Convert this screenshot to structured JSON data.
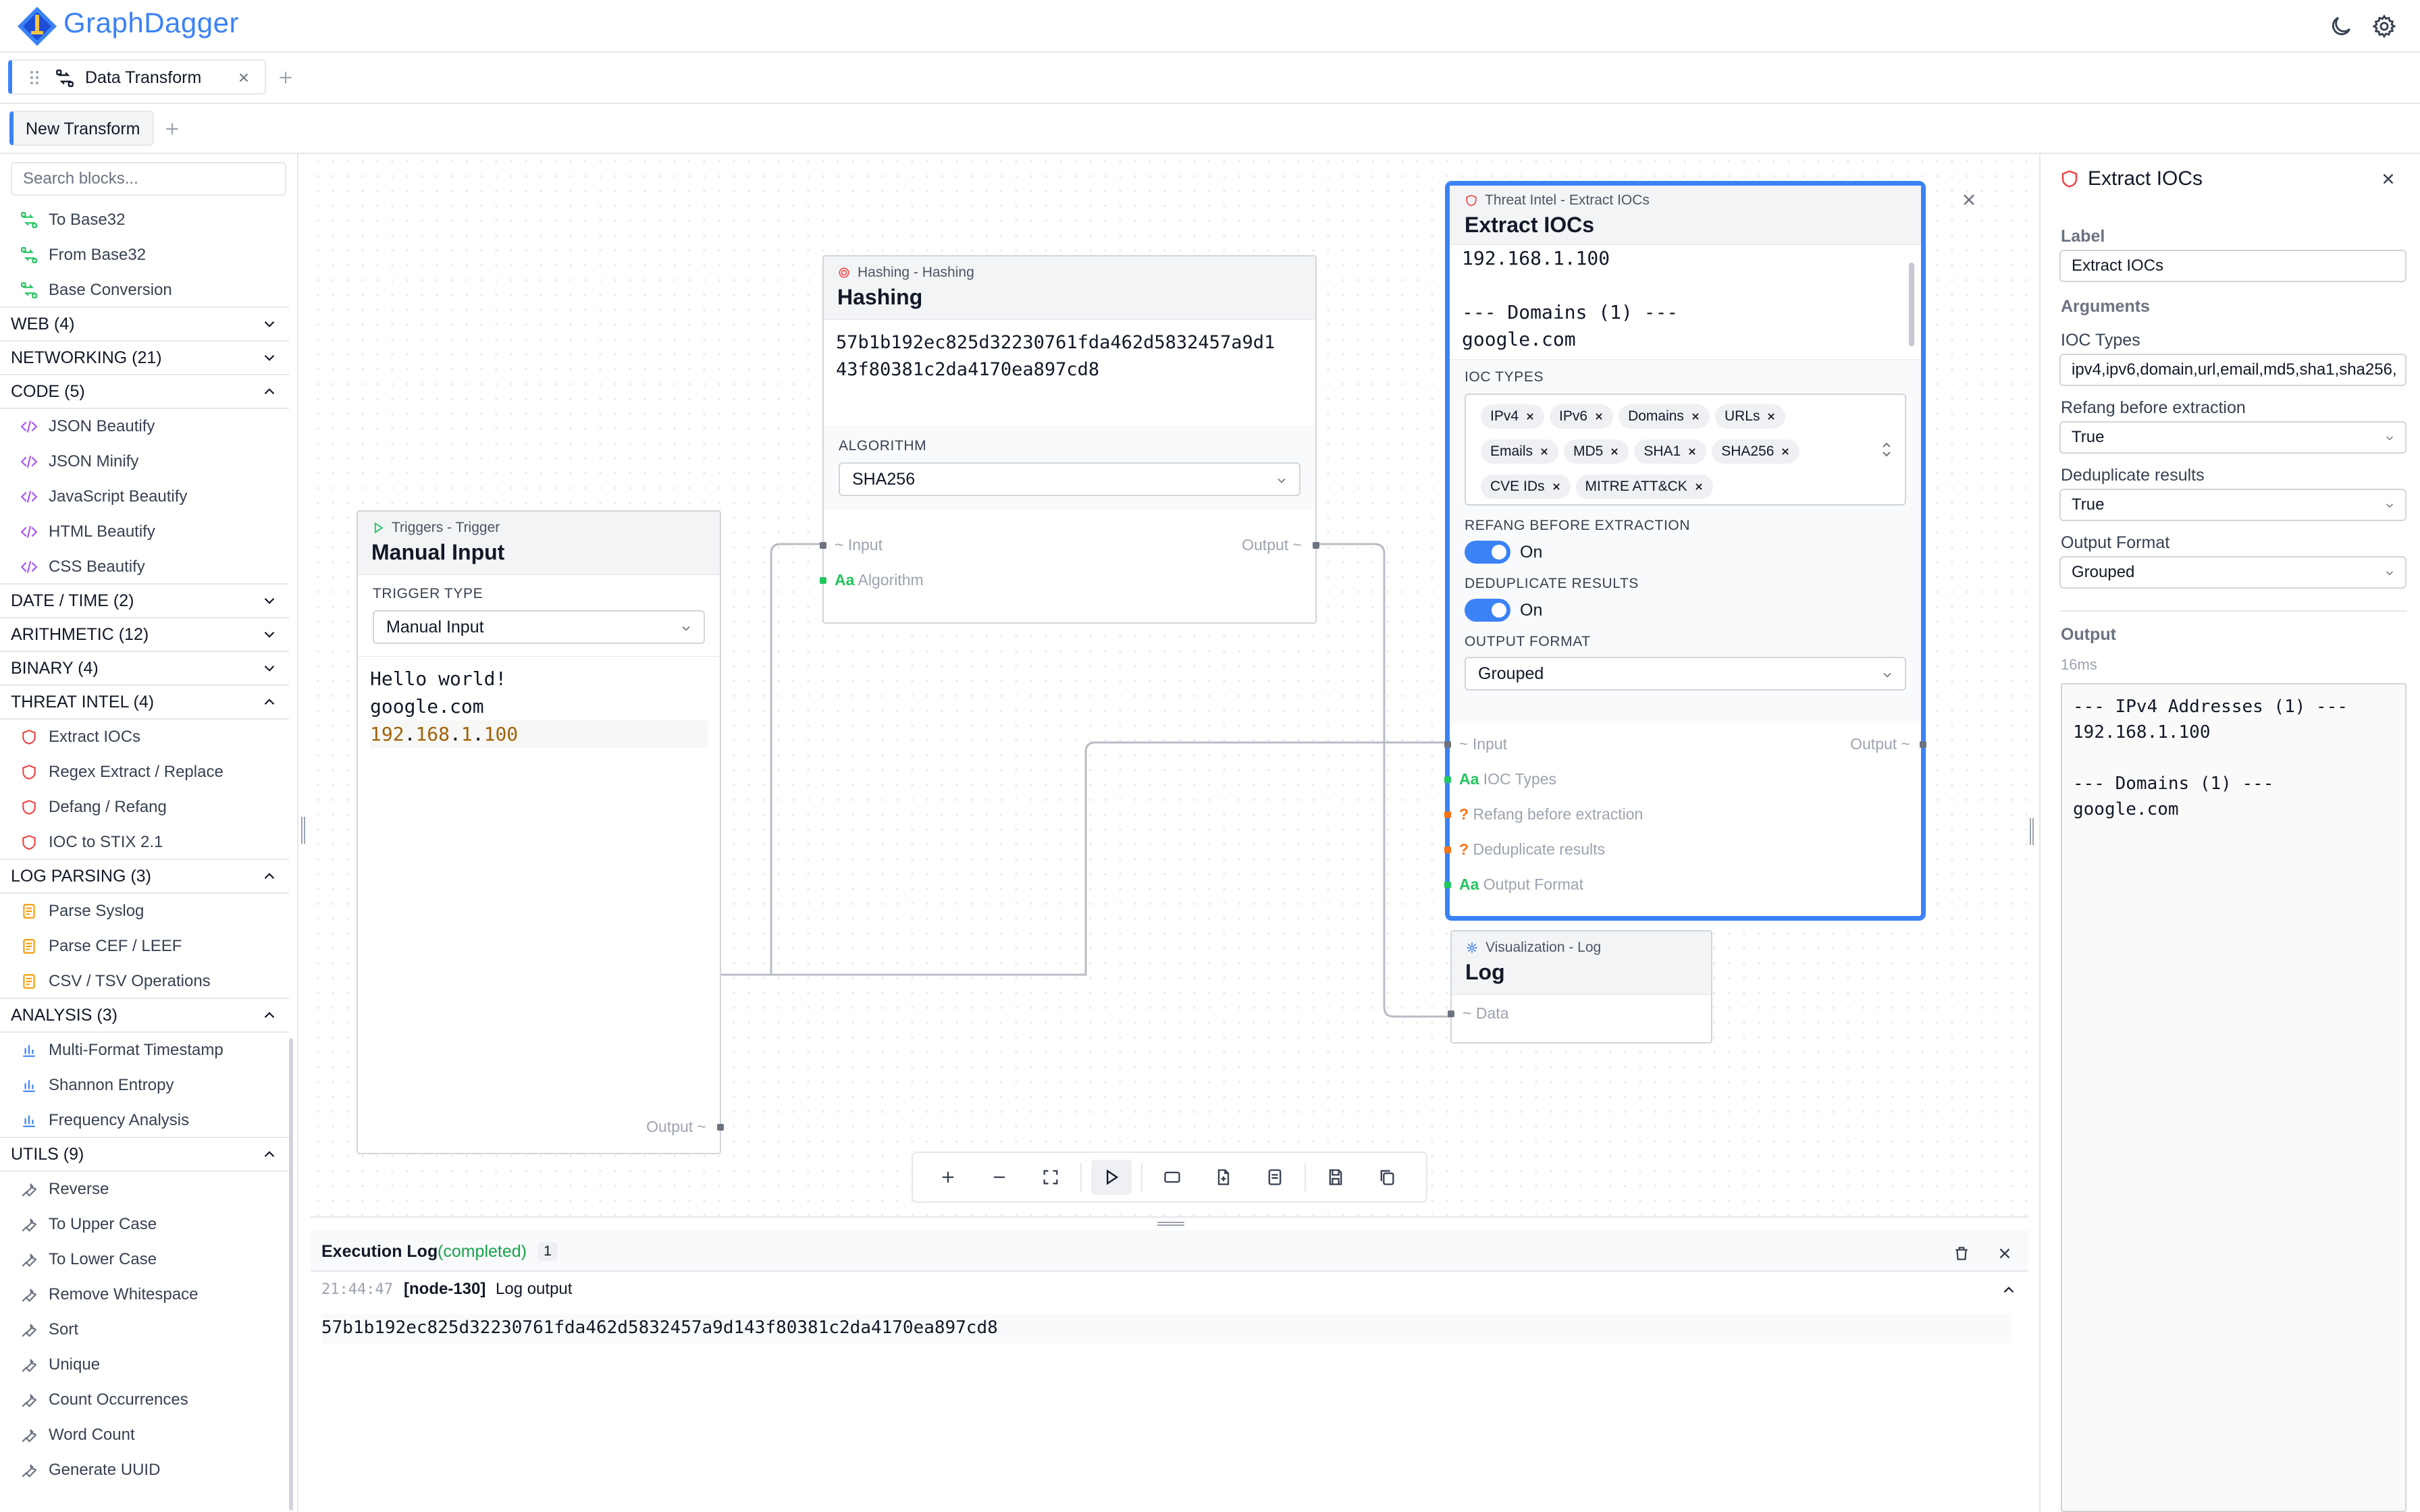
{
  "app": {
    "brand": "GraphDagger"
  },
  "tabs": [
    {
      "label": "Data Transform"
    }
  ],
  "subtabs": [
    {
      "label": "New Transform"
    }
  ],
  "sidebar": {
    "search_placeholder": "Search blocks...",
    "top_items": [
      "To Base32",
      "From Base32",
      "Base Conversion"
    ],
    "cat_web": "WEB (4)",
    "cat_networking": "NETWORKING (21)",
    "cat_code": "CODE (5)",
    "code_items": [
      "JSON Beautify",
      "JSON Minify",
      "JavaScript Beautify",
      "HTML Beautify",
      "CSS Beautify"
    ],
    "cat_datetime": "DATE / TIME (2)",
    "cat_arithmetic": "ARITHMETIC (12)",
    "cat_binary": "BINARY (4)",
    "cat_threat": "THREAT INTEL (4)",
    "threat_items": [
      "Extract IOCs",
      "Regex Extract / Replace",
      "Defang / Refang",
      "IOC to STIX 2.1"
    ],
    "cat_logparsing": "LOG PARSING (3)",
    "log_items": [
      "Parse Syslog",
      "Parse CEF / LEEF",
      "CSV / TSV Operations"
    ],
    "cat_analysis": "ANALYSIS (3)",
    "analysis_items": [
      "Multi-Format Timestamp",
      "Shannon Entropy",
      "Frequency Analysis"
    ],
    "cat_utils": "UTILS (9)",
    "utils_items": [
      "Reverse",
      "To Upper Case",
      "To Lower Case",
      "Remove Whitespace",
      "Sort",
      "Unique",
      "Count Occurrences",
      "Word Count",
      "Generate UUID"
    ]
  },
  "nodes": {
    "manual": {
      "subtitle": "Triggers - Trigger",
      "title": "Manual Input",
      "field_label": "TRIGGER TYPE",
      "select_value": "Manual Input",
      "text_lines": [
        "Hello world!",
        "google.com"
      ],
      "ip_parts": [
        "192",
        ".",
        "168",
        ".",
        "1",
        ".",
        "100"
      ],
      "output_label": "Output ~"
    },
    "hashing": {
      "subtitle": "Hashing - Hashing",
      "title": "Hashing",
      "hash_line1": "57b1b192ec825d32230761fda462d5832457a9d1",
      "hash_line2": "43f80381c2da4170ea897cd8",
      "field_label": "ALGORITHM",
      "select_value": "SHA256",
      "input_label": "~ Input",
      "output_label": "Output ~",
      "algo_prefix": "Aa",
      "algo_label": "Algorithm"
    },
    "ioc": {
      "subtitle": "Threat Intel - Extract IOCs",
      "title": "Extract IOCs",
      "preview_lines": [
        "192.168.1.100",
        "",
        "--- Domains (1) ---",
        "google.com"
      ],
      "ioc_types_label": "IOC TYPES",
      "chips": [
        "IPv4",
        "IPv6",
        "Domains",
        "URLs",
        "Emails",
        "MD5",
        "SHA1",
        "SHA256",
        "CVE IDs",
        "MITRE ATT&CK"
      ],
      "refang_label": "REFANG BEFORE EXTRACTION",
      "refang_value": "On",
      "dedup_label": "DEDUPLICATE RESULTS",
      "dedup_value": "On",
      "format_label": "OUTPUT FORMAT",
      "format_value": "Grouped",
      "ports": {
        "input": "~ Input",
        "output": "Output ~",
        "ioc_types_prefix": "Aa",
        "ioc_types": "IOC Types",
        "refang_prefix": "?",
        "refang": "Refang before extraction",
        "dedup_prefix": "?",
        "dedup": "Deduplicate results",
        "format_prefix": "Aa",
        "format": "Output Format"
      }
    },
    "log": {
      "subtitle": "Visualization - Log",
      "title": "Log",
      "data_label": "~ Data"
    }
  },
  "exec_log": {
    "title": "Execution Log",
    "status": "(completed)",
    "count": "1",
    "time": "21:44:47",
    "node": "[node-130]",
    "message": "Log output",
    "output": "57b1b192ec825d32230761fda462d5832457a9d143f80381c2da4170ea897cd8"
  },
  "panel": {
    "title": "Extract IOCs",
    "label_label": "Label",
    "label_value": "Extract IOCs",
    "arguments_head": "Arguments",
    "ioc_types_label": "IOC Types",
    "ioc_types_value": "ipv4,ipv6,domain,url,email,md5,sha1,sha256,",
    "refang_label": "Refang before extraction",
    "refang_value": "True",
    "dedup_label": "Deduplicate results",
    "dedup_value": "True",
    "format_label": "Output Format",
    "format_value": "Grouped",
    "output_head": "Output",
    "timing": "16ms",
    "output_text": "--- IPv4 Addresses (1) ---\n192.168.1.100\n\n--- Domains (1) ---\ngoogle.com"
  },
  "colors": {
    "accent": "#3b82f6",
    "success": "#16a34a",
    "ip_highlight": "#a16207",
    "threat_icon": "#ef4444",
    "code_icon": "#a855f7",
    "log_icon": "#f59e0b",
    "analysis_icon": "#3b82f6",
    "transform_icon": "#22c55e"
  }
}
